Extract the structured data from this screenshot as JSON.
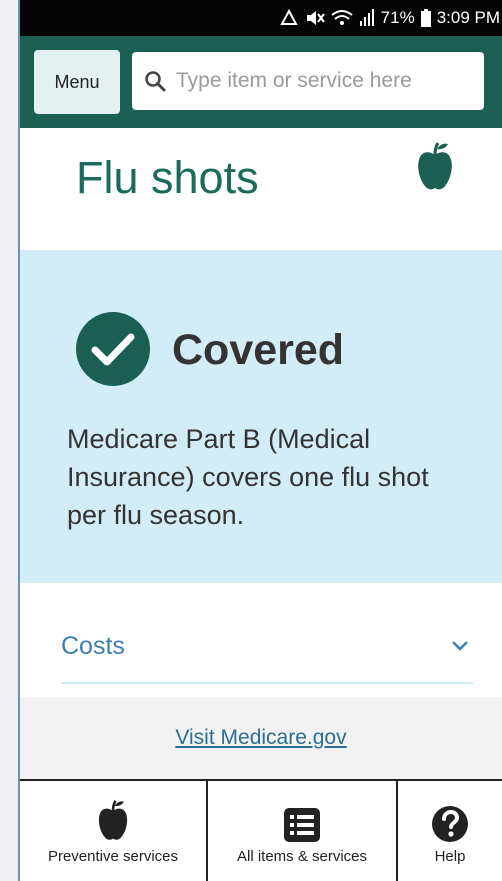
{
  "status_bar": {
    "battery": "71%",
    "time": "3:09 PM"
  },
  "header": {
    "menu_label": "Menu",
    "search_placeholder": "Type item or service here",
    "brand_color": "#1b5e52"
  },
  "page": {
    "title": "Flu shots"
  },
  "coverage": {
    "status": "Covered",
    "description": "Medicare Part B (Medical Insurance) covers one flu shot per flu season.",
    "card_color": "#d2edf8"
  },
  "costs": {
    "label": "Costs"
  },
  "footer": {
    "link_text": "Visit Medicare.gov"
  },
  "bottom_nav": {
    "items": [
      {
        "label": "Preventive services",
        "icon": "apple-icon"
      },
      {
        "label": "All items & services",
        "icon": "list-icon"
      },
      {
        "label": "Help",
        "icon": "question-icon"
      }
    ]
  }
}
